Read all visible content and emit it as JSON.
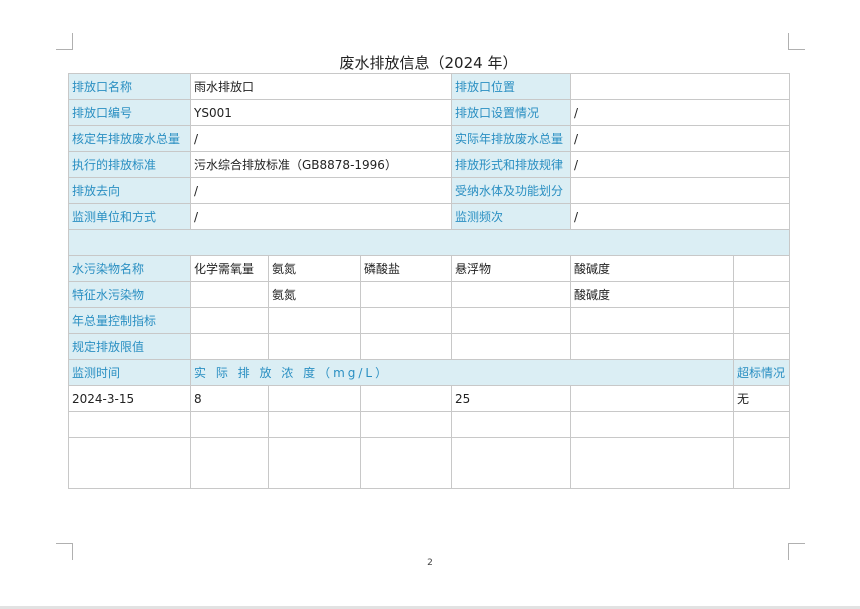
{
  "title": "废水排放信息（2024 年）",
  "info_rows": [
    {
      "l1": "排放口名称",
      "v1": "雨水排放口",
      "l2": "排放口位置",
      "v2": ""
    },
    {
      "l1": "排放口编号",
      "v1": "YS001",
      "l2": "排放口设置情况",
      "v2": "/"
    },
    {
      "l1": "核定年排放废水总量",
      "v1": "/",
      "l2": "实际年排放废水总量",
      "v2": "/"
    },
    {
      "l1": "执行的排放标准",
      "v1": "污水综合排放标准（GB8878-1996）",
      "l2": "排放形式和排放规律",
      "v2": "/"
    },
    {
      "l1": "排放去向",
      "v1": "/",
      "l2": "受纳水体及功能划分",
      "v2": ""
    },
    {
      "l1": "监测单位和方式",
      "v1": "/",
      "l2": "监测频次",
      "v2": "/"
    }
  ],
  "pollutants": {
    "label": "水污染物名称",
    "items": [
      "化学需氧量",
      "氨氮",
      "磷酸盐",
      "悬浮物",
      "酸碱度"
    ]
  },
  "characteristic": {
    "label": "特征水污染物",
    "cells": [
      "",
      "氨氮",
      "",
      "",
      "酸碱度",
      ""
    ]
  },
  "annual_limit": {
    "label": "年总量控制指标"
  },
  "discharge_limit": {
    "label": "规定排放限值"
  },
  "monitor_header": {
    "time_label": "监测时间",
    "conc_label": "实 际 排 放 浓 度（mg/L）",
    "exceed_label": "超标情况"
  },
  "monitor_rows": [
    {
      "date": "2024-3-15",
      "c1": "8",
      "c2": "",
      "c3": "",
      "c4": "25",
      "c5": "",
      "exceed": "无"
    }
  ],
  "page_number": "2"
}
